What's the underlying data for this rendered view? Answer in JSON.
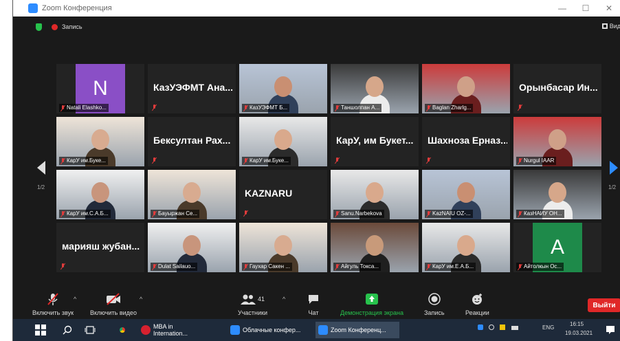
{
  "window": {
    "title": "Zoom Конференция",
    "minimize": "—",
    "maximize": "☐",
    "close": "✕"
  },
  "topbar": {
    "recording_label": "Запись",
    "view_label": "Вид"
  },
  "pager": {
    "left": "1/2",
    "right": "1/2"
  },
  "tiles": [
    {
      "type": "avatar",
      "letter": "N",
      "avatar_color": "#8a4fc6",
      "name": "Natali Elashko..."
    },
    {
      "type": "name",
      "name": "КазУЭФМТ Ана..."
    },
    {
      "type": "video",
      "name": "КазУЭФМТ Б..."
    },
    {
      "type": "video",
      "name": "Таншолпан А..."
    },
    {
      "type": "video",
      "name": "Baglan Zharlg..."
    },
    {
      "type": "name",
      "name": "Орынбасар Ин..."
    },
    {
      "type": "video",
      "name": "КарУ им.Буке..."
    },
    {
      "type": "name",
      "name": "Бексултан Рах..."
    },
    {
      "type": "video",
      "name": "КарУ им.Буке..."
    },
    {
      "type": "name",
      "name": "КарУ, им Букет..."
    },
    {
      "type": "name",
      "name": "Шахноза Ерназ..."
    },
    {
      "type": "video",
      "name": "Nurgul IAAR"
    },
    {
      "type": "video",
      "name": "КарУ им.С.А.Б..."
    },
    {
      "type": "video",
      "name": "Бауыржан Се..."
    },
    {
      "type": "name",
      "name": "KAZNARU"
    },
    {
      "type": "video",
      "name": "Sanu.Narbekova",
      "active": true
    },
    {
      "type": "video",
      "name": "KazNAIU OZ-..."
    },
    {
      "type": "video",
      "name": "КазНАИУ ОН..."
    },
    {
      "type": "name",
      "name": "марияш жубан..."
    },
    {
      "type": "video",
      "name": "Dulat Sailauo..."
    },
    {
      "type": "video",
      "name": "Гаухар Сакен ..."
    },
    {
      "type": "video",
      "name": "Айгуль Токса..."
    },
    {
      "type": "video",
      "name": "КарУ им.Е.А.Б..."
    },
    {
      "type": "avatar",
      "letter": "A",
      "avatar_color": "#1e8a4a",
      "name": "Айтолкын Ос..."
    }
  ],
  "toolbar": {
    "unmute": "Включить звук",
    "start_video": "Включить видео",
    "participants": "Участники",
    "participants_count": "41",
    "chat": "Чат",
    "share": "Демонстрация экрана",
    "record": "Запись",
    "reactions": "Реакции",
    "leave": "Выйти"
  },
  "taskbar": {
    "items": [
      "MBA in Internation...",
      "Облачные конфер...",
      "Zoom Конференц..."
    ],
    "lang": "ENG",
    "time": "16:15",
    "date": "19.03.2021"
  },
  "colors": {
    "accent": "#2d8cff",
    "share_green": "#27c24c",
    "leave_red": "#e02828",
    "active_speaker": "#c7e33c"
  }
}
